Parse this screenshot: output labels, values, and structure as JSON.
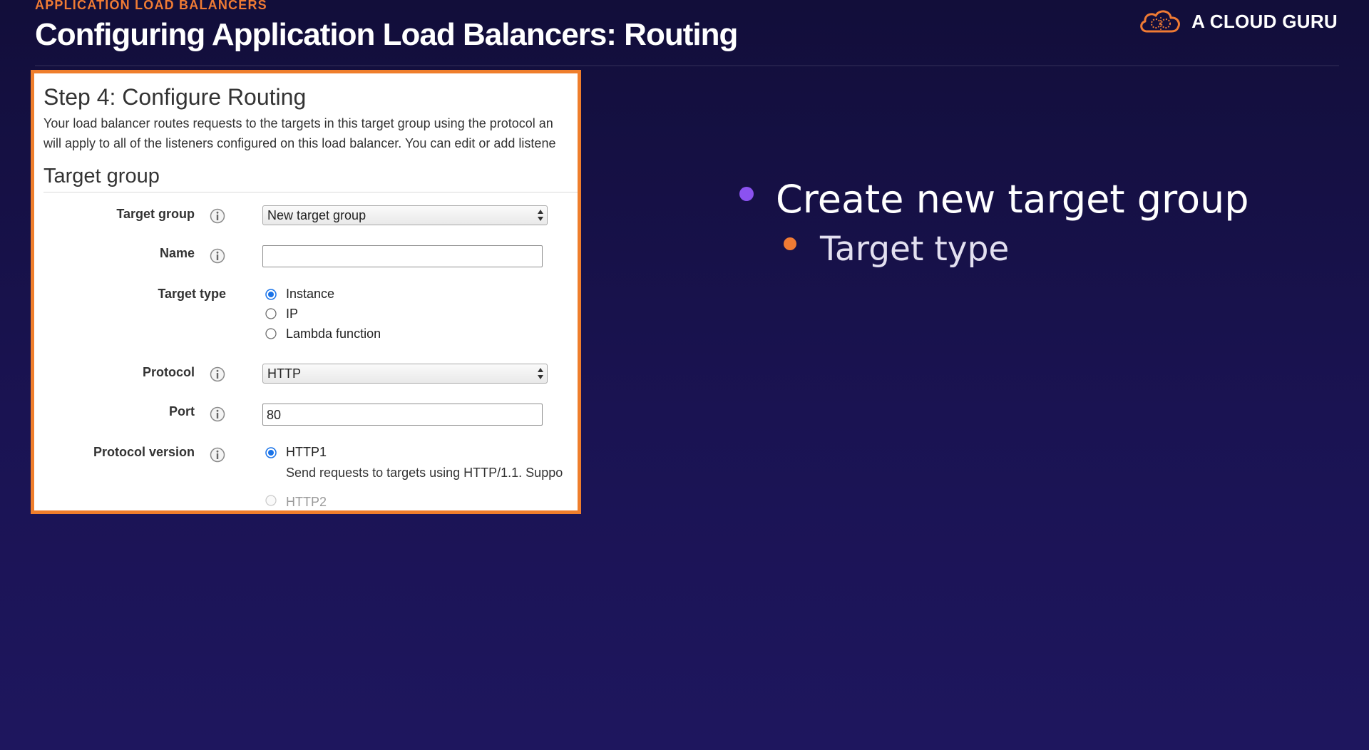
{
  "header": {
    "eyebrow": "APPLICATION LOAD BALANCERS",
    "title": "Configuring Application Load Balancers: Routing",
    "brand_name": "A CLOUD GURU",
    "brand_icon": "cloud-logo-icon"
  },
  "panel": {
    "step_title": "Step 4: Configure Routing",
    "description_line1": "Your load balancer routes requests to the targets in this target group using the protocol an",
    "description_line2": "will apply to all of the listeners configured on this load balancer. You can edit or add listene",
    "section_title": "Target group",
    "target_group": {
      "label": "Target group",
      "selected": "New target group"
    },
    "name": {
      "label": "Name",
      "value": ""
    },
    "target_type": {
      "label": "Target type",
      "options": [
        {
          "label": "Instance",
          "selected": true
        },
        {
          "label": "IP",
          "selected": false
        },
        {
          "label": "Lambda function",
          "selected": false
        }
      ]
    },
    "protocol": {
      "label": "Protocol",
      "selected": "HTTP"
    },
    "port": {
      "label": "Port",
      "value": "80"
    },
    "protocol_version": {
      "label": "Protocol version",
      "options": [
        {
          "label": "HTTP1",
          "selected": true,
          "help": "Send requests to targets using HTTP/1.1. Suppo"
        },
        {
          "label": "HTTP2",
          "selected": false,
          "disabled": true
        }
      ]
    }
  },
  "bullets": [
    {
      "text": "Create new target group",
      "level": 1,
      "color": "#8b52f0"
    },
    {
      "text": "Target type",
      "level": 2,
      "color": "#f07b34"
    }
  ],
  "colors": {
    "accent_orange": "#f07b34",
    "accent_purple": "#8b52f0",
    "background": "#1a1352",
    "radio_selected": "#1a73e8"
  }
}
